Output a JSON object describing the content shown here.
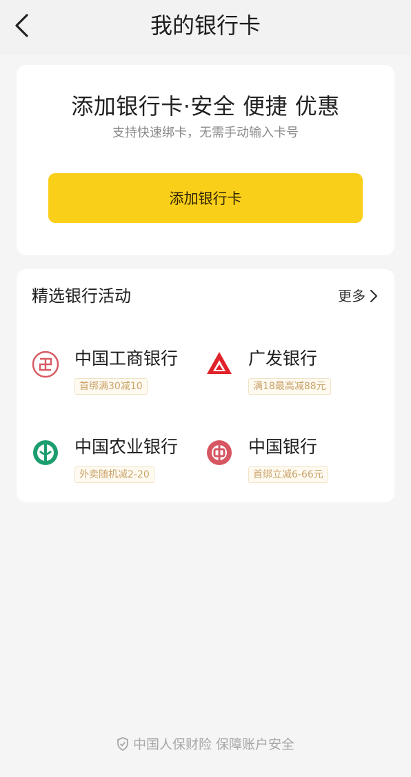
{
  "nav": {
    "title": "我的银行卡"
  },
  "add_card": {
    "title": "添加银行卡·安全 便捷 优惠",
    "subtitle": "支持快速绑卡，无需手动输入卡号",
    "button_label": "添加银行卡"
  },
  "activities": {
    "title": "精选银行活动",
    "more_label": "更多",
    "banks": [
      {
        "name": "中国工商银行",
        "tag": "首绑满30减10",
        "icon": "icbc-logo-icon",
        "color": "#c8102e"
      },
      {
        "name": "广发银行",
        "tag": "满18最高减88元",
        "icon": "cgb-logo-icon",
        "color": "#e0232a"
      },
      {
        "name": "中国农业银行",
        "tag": "外卖随机减2-20",
        "icon": "abc-logo-icon",
        "color": "#1d9e6f"
      },
      {
        "name": "中国银行",
        "tag": "首绑立减6-66元",
        "icon": "boc-logo-icon",
        "color": "#b8121f"
      }
    ]
  },
  "footer": {
    "note": "中国人保财险 保障账户安全",
    "icon": "shield-icon"
  }
}
